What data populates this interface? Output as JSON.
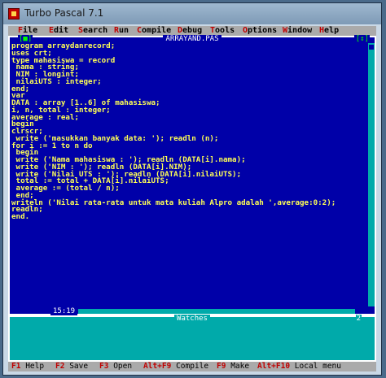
{
  "window": {
    "title": "Turbo Pascal 7.1"
  },
  "menu": [
    {
      "hotkey": "F",
      "rest": "ile"
    },
    {
      "hotkey": "E",
      "rest": "dit"
    },
    {
      "hotkey": "S",
      "rest": "earch"
    },
    {
      "hotkey": "R",
      "rest": "un"
    },
    {
      "hotkey": "C",
      "rest": "ompile"
    },
    {
      "hotkey": "D",
      "rest": "ebug"
    },
    {
      "hotkey": "T",
      "rest": "ools"
    },
    {
      "hotkey": "O",
      "rest": "ptions"
    },
    {
      "hotkey": "W",
      "rest": "indow"
    },
    {
      "hotkey": "H",
      "rest": "elp"
    }
  ],
  "editor": {
    "filename": "ARRAYAND.PAS",
    "close_glyph": "[■]",
    "window_number": "1",
    "zoom_glyph": "[↕]",
    "cursor_position": "15:19",
    "lines": [
      "program arraydanrecord;",
      "uses crt;",
      "type mahasiswa = record",
      " nama : string;",
      " NIM : longint;",
      " nilaiUTS : integer;",
      "end;",
      "var",
      "DATA : array [1..6] of mahasiswa;",
      "i, n, total : integer;",
      "average : real;",
      "begin",
      "clrscr;",
      " write ('masukkan banyak data: '); readln (n);",
      "for i := 1 to n do",
      " begin",
      " write ('Nama mahasiswa : '); readln (DATA[i].nama);",
      " write ('NIM : '); readln (DATA[i].NIM);",
      " write ('Nilai UTS : '); readln (DATA[i].nilaiUTS);",
      " total := total + DATA[i].nilaiUTS;",
      " average := (total / n);",
      " end;",
      "writeln ('Nilai rata-rata untuk mata kuliah Alpro adalah ',average:0:2);",
      "readln;",
      "end."
    ]
  },
  "watches": {
    "title": "Watches",
    "window_number": "2"
  },
  "statusbar": [
    {
      "key": "F1",
      "label": "Help"
    },
    {
      "key": "F2",
      "label": "Save"
    },
    {
      "key": "F3",
      "label": "Open"
    },
    {
      "key": "Alt+F9",
      "label": "Compile"
    },
    {
      "key": "F9",
      "label": "Make"
    },
    {
      "key": "Alt+F10",
      "label": "Local menu"
    }
  ]
}
